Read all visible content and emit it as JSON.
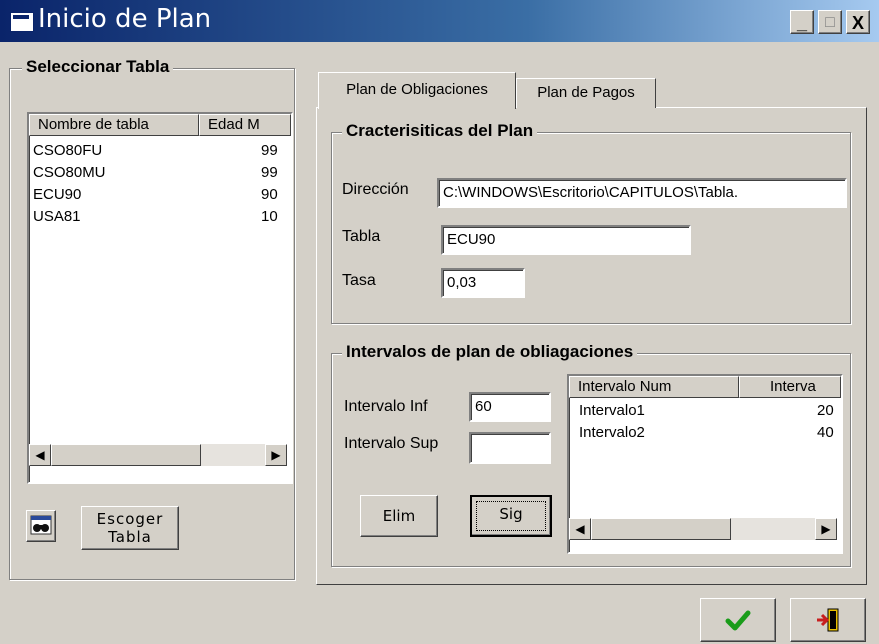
{
  "window": {
    "title": "Inicio de Plan",
    "minimize": "_",
    "maximize": "□",
    "close": "X"
  },
  "left_group": {
    "title": "Seleccionar Tabla",
    "columns": [
      "Nombre de tabla",
      "Edad M"
    ],
    "rows": [
      [
        "CSO80FU",
        "99"
      ],
      [
        "CSO80MU",
        "99"
      ],
      [
        "ECU90",
        "90"
      ],
      [
        "USA81",
        "10"
      ]
    ],
    "choose_button": "Escoger\nTabla",
    "choose_icon": "binoculars-icon"
  },
  "tabs": [
    "Plan de Obligaciones",
    "Plan de Pagos"
  ],
  "characteristics": {
    "title": "Cracterisiticas del Plan",
    "direccion_label": "Dirección",
    "direccion_value": "C:\\WINDOWS\\Escritorio\\CAPITULOS\\Tabla.",
    "tabla_label": "Tabla",
    "tabla_value": "ECU90",
    "tasa_label": "Tasa",
    "tasa_value": "0,03"
  },
  "intervals": {
    "title": "Intervalos de plan de obliagaciones",
    "inf_label": "Intervalo Inf",
    "inf_value": "60",
    "sup_label": "Intervalo Sup",
    "sup_value": "",
    "elim_button": "Elim",
    "sig_button": "Sig",
    "columns": [
      "Intervalo Num",
      "Interva"
    ],
    "rows": [
      [
        "Intervalo1",
        "20"
      ],
      [
        "Intervalo2",
        "40"
      ]
    ]
  },
  "footer": {
    "ok_icon": "checkmark-icon",
    "exit_icon": "exit-door-icon"
  },
  "colors": {
    "titlebar": "#0a246a",
    "check": "#1a9c1a",
    "exit": "#c81e1e",
    "face": "#d4d0c8"
  }
}
